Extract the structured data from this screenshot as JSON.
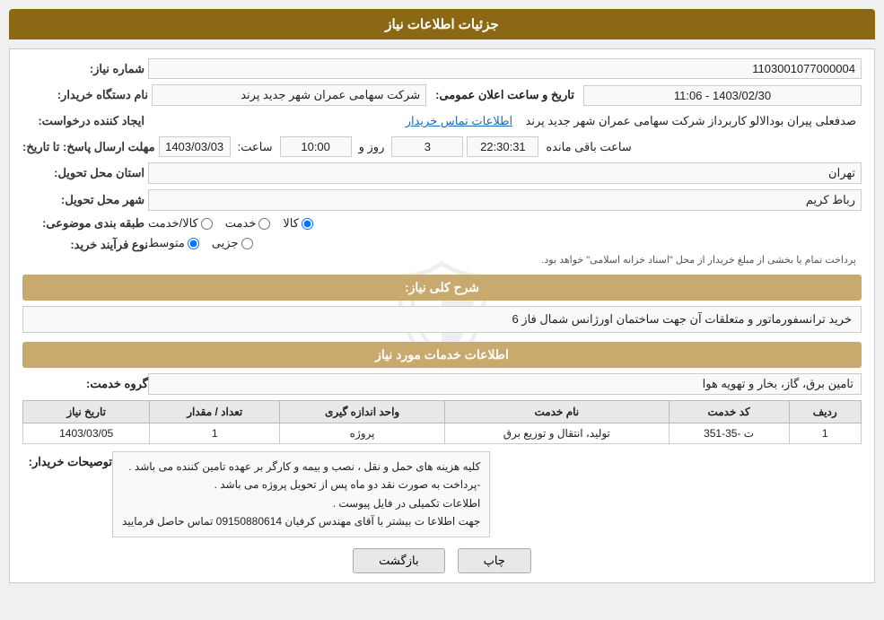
{
  "page": {
    "title": "جزئیات اطلاعات نیاز"
  },
  "header": {
    "label": "شماره نیاز:",
    "value": "1103001077000004",
    "buyer_label": "نام دستگاه خریدار:",
    "buyer_value": "شرکت سهامی عمران شهر جدید پرند",
    "requester_label": "ایجاد کننده درخواست:",
    "requester_value": "صدفعلی پیران بودالالو کاربرداز شرکت سهامی عمران شهر جدید پرند",
    "contact_link": "اطلاعات تماس خریدار",
    "response_label": "مهلت ارسال پاسخ: تا تاریخ:",
    "date_value": "1403/03/03",
    "time_label": "ساعت:",
    "time_value": "10:00",
    "day_label": "روز و",
    "day_count": "3",
    "remaining_label": "ساعت باقی مانده",
    "remaining_time": "22:30:31",
    "announce_label": "تاریخ و ساعت اعلان عمومی:",
    "announce_value": "1403/02/30 - 11:06",
    "province_label": "استان محل تحویل:",
    "province_value": "تهران",
    "city_label": "شهر محل تحویل:",
    "city_value": "رباط کریم",
    "category_label": "طبقه بندی موضوعی:",
    "category_options": [
      "کالا",
      "خدمت",
      "کالا/خدمت"
    ],
    "category_selected": "کالا",
    "purchase_label": "نوع فرآیند خرید:",
    "purchase_options": [
      "جزیی",
      "متوسط"
    ],
    "purchase_selected": "متوسط",
    "purchase_note": "پرداخت تمام یا بخشی از مبلغ خریدار از محل \"اسناد خزانه اسلامی\" خواهد بود.",
    "description_label": "شرح کلی نیاز:",
    "description_value": "خرید ترانسفورماتور و متعلقات آن جهت ساختمان اورژانس شمال فاز 6"
  },
  "services": {
    "section_title": "اطلاعات خدمات مورد نیاز",
    "group_label": "گروه خدمت:",
    "group_value": "تامین برق، گاز، بخار و تهویه هوا",
    "table": {
      "columns": [
        "ردیف",
        "کد خدمت",
        "نام خدمت",
        "واحد اندازه گیری",
        "تعداد / مقدار",
        "تاریخ نیاز"
      ],
      "rows": [
        {
          "index": "1",
          "code": "ت -35-351",
          "name": "تولید، انتقال و توزیع برق",
          "unit": "پروژه",
          "quantity": "1",
          "date": "1403/03/05"
        }
      ]
    }
  },
  "buyer_desc": {
    "label": "توصیحات خریدار:",
    "lines": [
      "کلیه هزینه های حمل و نقل ، نصب و بیمه و کارگر بر عهده تامین کننده  می باشد .",
      "-پرداخت به صورت نقد دو ماه پس از تحویل پروژه  می باشد .",
      "اطلاعات تکمیلی در فایل پیوست .",
      "جهت اطلاعا ت بیشتر با آقای مهندس کرفیان  09150880614 تماس حاصل فرمایید"
    ]
  },
  "buttons": {
    "print": "چاپ",
    "back": "بازگشت"
  }
}
